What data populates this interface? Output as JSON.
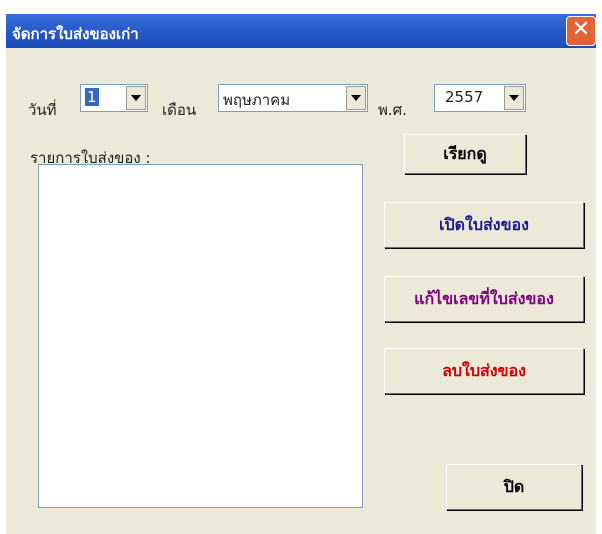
{
  "window": {
    "title": "จัดการใบส่งของเก่า",
    "close_glyph": "✕"
  },
  "date_row": {
    "day_label": "วันที่",
    "day_value": "1",
    "month_label": "เดือน",
    "month_value": "พฤษภาคม",
    "year_label": "พ.ศ.",
    "year_value": "2557"
  },
  "list": {
    "label": "รายการใบส่งของ :"
  },
  "buttons": {
    "retrieve": "เรียกดู",
    "open": "เปิดใบส่งของ",
    "edit_number": "แก้ไขเลขที่ใบส่งของ",
    "delete": "ลบใบส่งของ",
    "close": "ปิด"
  },
  "colors": {
    "open": "#1c1c8c",
    "edit_number": "#800080",
    "delete": "#d40000",
    "default": "#000000"
  }
}
